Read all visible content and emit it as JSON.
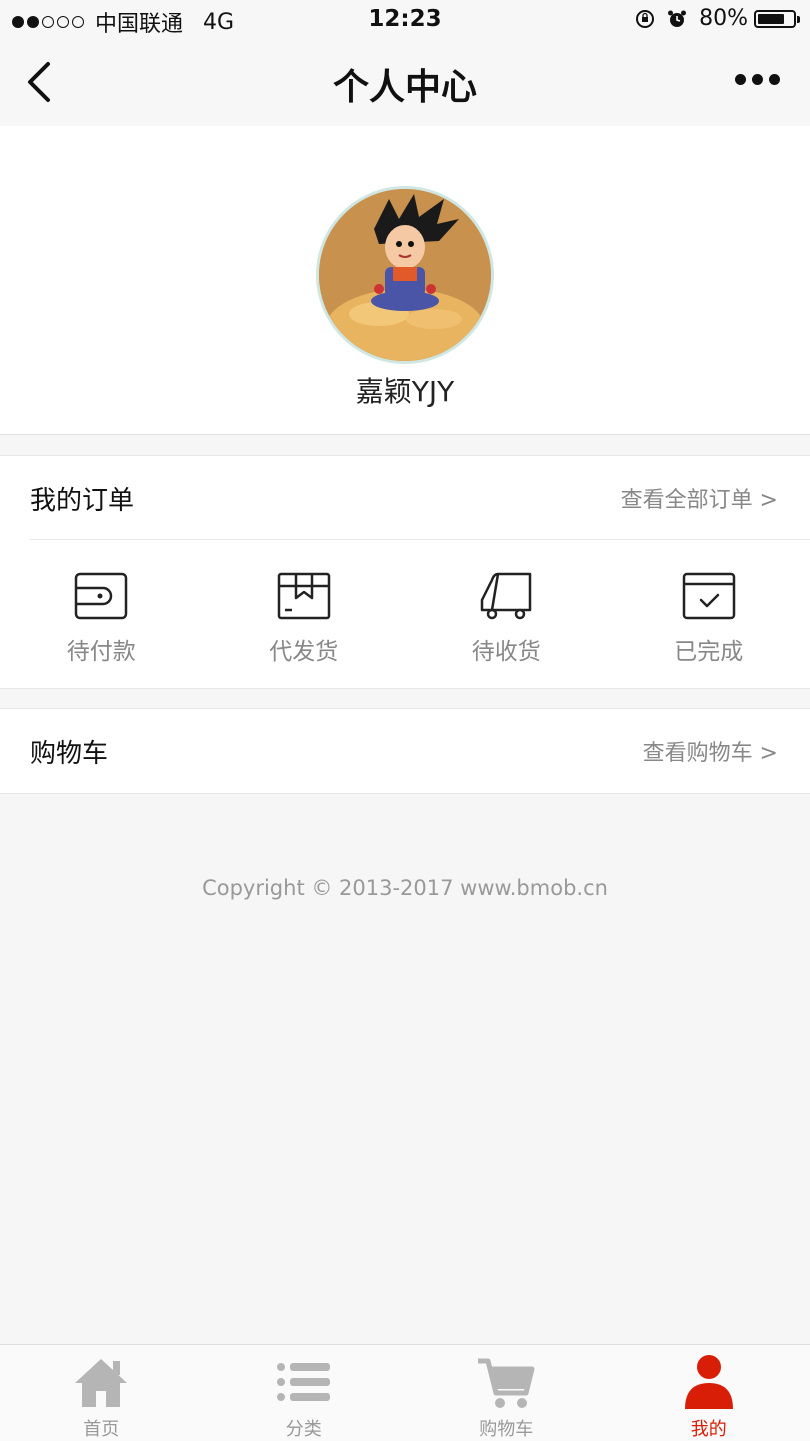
{
  "status_bar": {
    "carrier": "中国联通",
    "network": "4G",
    "time": "12:23",
    "battery": "80%",
    "battery_level": 0.8,
    "signal_bars_filled": 2,
    "signal_bars_total": 5
  },
  "nav": {
    "title": "个人中心",
    "back_icon": "chevron-left-icon",
    "more_icon": "more-dots-icon"
  },
  "profile": {
    "username": "嘉颖YJY",
    "avatar_icon": "avatar-image"
  },
  "orders": {
    "title": "我的订单",
    "view_all": "查看全部订单 >",
    "items": [
      {
        "label": "待付款",
        "icon": "wallet-icon"
      },
      {
        "label": "代发货",
        "icon": "package-icon"
      },
      {
        "label": "待收货",
        "icon": "truck-icon"
      },
      {
        "label": "已完成",
        "icon": "calendar-check-icon"
      }
    ]
  },
  "cart": {
    "title": "购物车",
    "view": "查看购物车 >"
  },
  "footer": {
    "copyright": "Copyright © 2013-2017 www.bmob.cn"
  },
  "tab_bar": {
    "tabs": [
      {
        "label": "首页",
        "icon": "home-icon",
        "active": false
      },
      {
        "label": "分类",
        "icon": "list-icon",
        "active": false
      },
      {
        "label": "购物车",
        "icon": "cart-icon",
        "active": false
      },
      {
        "label": "我的",
        "icon": "user-icon",
        "active": true
      }
    ],
    "active_color": "#d81e06",
    "inactive_color": "#b5b5b5"
  }
}
